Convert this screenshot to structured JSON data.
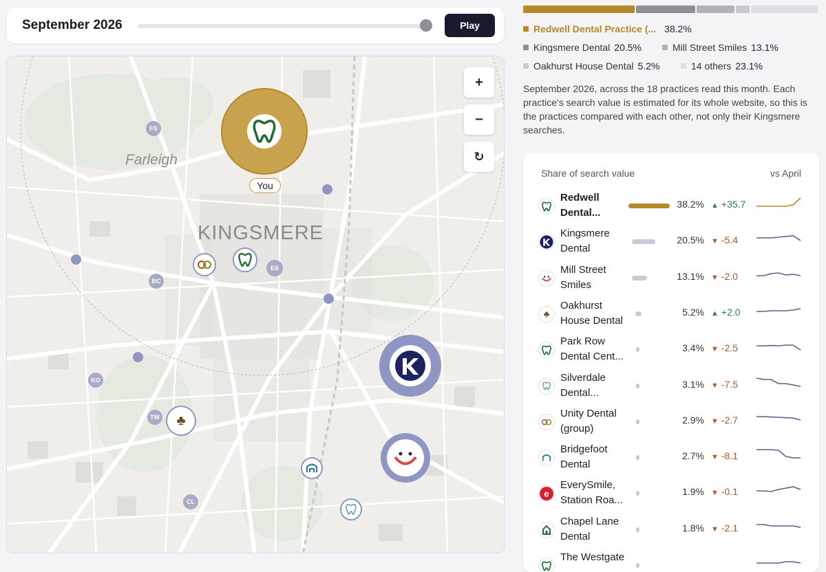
{
  "timeline": {
    "month": "September 2026",
    "play_label": "Play",
    "progress": 1.0
  },
  "map": {
    "place_label": "Farleigh",
    "town_label": "KINGSMERE",
    "zoom_in": "+",
    "zoom_out": "−",
    "reset": "↻",
    "you_label": "You",
    "abbreviations": [
      "FS",
      "BC",
      "ES",
      "KO",
      "TW",
      "CL"
    ]
  },
  "legend": [
    {
      "name": "Redwell Dental Practice (...",
      "pct": "38.2%",
      "color": "#b5892a",
      "highlight": true
    },
    {
      "name": "Kingsmere Dental",
      "pct": "20.5%",
      "color": "#8f8f96"
    },
    {
      "name": "Mill Street Smiles",
      "pct": "13.1%",
      "color": "#b2b2b7"
    },
    {
      "name": "Oakhurst House Dental",
      "pct": "5.2%",
      "color": "#c9c9cd"
    },
    {
      "name": "14 others",
      "pct": "23.1%",
      "color": "#dedee2"
    }
  ],
  "description": "September 2026, across the 18 practices read this month. Each practice's search value is estimated for its whole website, so this is the practices compared with each other, not only their Kingsmere searches.",
  "table": {
    "header_left": "Share of search value",
    "header_right": "vs April",
    "rows": [
      {
        "name": "Redwell Dental...",
        "share": 38.2,
        "pct": "38.2%",
        "dir": "up",
        "change": "+35.7",
        "icon": "tooth-icon",
        "bold": true,
        "trend": [
          3,
          3,
          3,
          3,
          3,
          4,
          9
        ]
      },
      {
        "name": "Kingsmere Dental",
        "share": 20.5,
        "pct": "20.5%",
        "dir": "down",
        "change": "-5.4",
        "icon": "k-logo-icon",
        "trend": [
          6,
          6,
          6,
          6.5,
          7,
          7.5,
          4
        ]
      },
      {
        "name": "Mill Street Smiles",
        "share": 13.1,
        "pct": "13.1%",
        "dir": "down",
        "change": "-2.0",
        "icon": "smile-icon",
        "trend": [
          5,
          5,
          6.5,
          7,
          5.5,
          6,
          5
        ]
      },
      {
        "name": "Oakhurst House Dental",
        "share": 5.2,
        "pct": "5.2%",
        "dir": "up",
        "change": "+2.0",
        "icon": "oak-tooth-icon",
        "trend": [
          5,
          5,
          5.5,
          5.5,
          5.5,
          6,
          7
        ]
      },
      {
        "name": "Park Row Dental Cent...",
        "share": 3.4,
        "pct": "3.4%",
        "dir": "down",
        "change": "-2.5",
        "icon": "tooth-icon",
        "trend": [
          6,
          6,
          6.2,
          6,
          6.5,
          6.5,
          3
        ]
      },
      {
        "name": "Silverdale Dental...",
        "share": 3.1,
        "pct": "3.1%",
        "dir": "down",
        "change": "-7.5",
        "icon": "silver-tooth-icon",
        "trend": [
          9,
          8,
          8,
          5,
          5,
          4,
          3
        ]
      },
      {
        "name": "Unity Dental (group)",
        "share": 2.9,
        "pct": "2.9%",
        "dir": "down",
        "change": "-2.7",
        "icon": "rings-icon",
        "trend": [
          7,
          7,
          6.7,
          6.5,
          6.2,
          6,
          4.5
        ]
      },
      {
        "name": "Bridgefoot Dental",
        "share": 2.7,
        "pct": "2.7%",
        "dir": "down",
        "change": "-8.1",
        "icon": "bridge-icon",
        "trend": [
          9,
          9,
          9,
          8.5,
          4,
          3,
          3
        ]
      },
      {
        "name": "EverySmile, Station Roa...",
        "share": 1.9,
        "pct": "1.9%",
        "dir": "down",
        "change": "-0.1",
        "icon": "e-logo-icon",
        "trend": [
          5,
          5,
          4.5,
          6,
          7,
          8,
          6
        ]
      },
      {
        "name": "Chapel Lane Dental",
        "share": 1.8,
        "pct": "1.8%",
        "dir": "down",
        "change": "-2.1",
        "icon": "chapel-icon",
        "trend": [
          7,
          7,
          6,
          6,
          6,
          6,
          5
        ]
      },
      {
        "name": "The Westgate",
        "share": 1.6,
        "pct": "",
        "dir": "",
        "change": "",
        "icon": "tooth-icon",
        "trend": [
          5,
          5,
          5,
          5,
          6,
          6,
          5
        ]
      }
    ]
  },
  "colors": {
    "gold": "#b5892a",
    "navy": "#1c2360",
    "up": "#2e7d4f",
    "down": "#b0552a",
    "spark": "#5a5e86"
  }
}
